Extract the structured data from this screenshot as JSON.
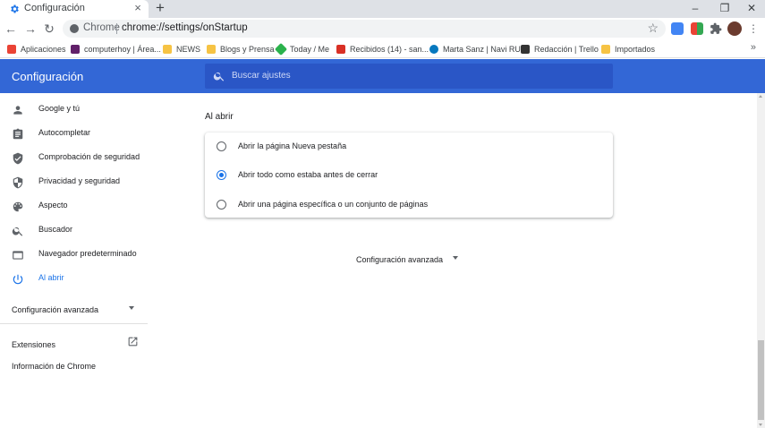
{
  "browser": {
    "tab_title": "Configuración",
    "tab_close": "×",
    "new_tab": "+",
    "window_buttons": {
      "minimize": "–",
      "restore": "❐",
      "close": "✕"
    },
    "nav": {
      "back": "←",
      "forward": "→",
      "reload": "↻"
    },
    "omnibox": {
      "site": "Chrome",
      "url": "chrome://settings/onStartup",
      "star": "☆"
    },
    "menu": "⋮",
    "colors": {
      "tabstrip": "#dee1e6",
      "accent": "#1a73e8"
    }
  },
  "bookmarks": [
    {
      "label": "Aplicaciones",
      "icon": "apps-grid-icon",
      "color": "#ea4335"
    },
    {
      "label": "computerhoy | Área...",
      "icon": "slack-icon",
      "color": "#611f69"
    },
    {
      "label": "NEWS",
      "icon": "folder-icon",
      "color": "#f6c344"
    },
    {
      "label": "Blogs y Prensa",
      "icon": "folder-icon",
      "color": "#f6c344"
    },
    {
      "label": "Today / Me",
      "icon": "feedly-icon",
      "color": "#2bb24c"
    },
    {
      "label": "Recibidos (14) - san...",
      "icon": "gmail-icon",
      "color": "#d93025"
    },
    {
      "label": "Marta Sanz | Navi RU",
      "icon": "drupal-icon",
      "color": "#0678be"
    },
    {
      "label": "Redacción | Trello",
      "icon": "trello-icon",
      "color": "#333333"
    },
    {
      "label": "Importados",
      "icon": "folder-icon",
      "color": "#f6c344"
    }
  ],
  "bookmarks_more": "»",
  "header": {
    "title": "Configuración",
    "search_placeholder": "Buscar ajustes",
    "color": "#3367d6"
  },
  "sidebar": {
    "items": [
      {
        "label": "Google y tú",
        "icon": "person-icon",
        "active": false
      },
      {
        "label": "Autocompletar",
        "icon": "clipboard-icon",
        "active": false
      },
      {
        "label": "Comprobación de seguridad",
        "icon": "shield-check-icon",
        "active": false
      },
      {
        "label": "Privacidad y seguridad",
        "icon": "shield-icon",
        "active": false
      },
      {
        "label": "Aspecto",
        "icon": "palette-icon",
        "active": false
      },
      {
        "label": "Buscador",
        "icon": "search-icon",
        "active": false
      },
      {
        "label": "Navegador predeterminado",
        "icon": "browser-icon",
        "active": false
      },
      {
        "label": "Al abrir",
        "icon": "power-icon",
        "active": true
      }
    ],
    "advanced": "Configuración avanzada",
    "extensions": "Extensiones",
    "about": "Información de Chrome"
  },
  "main": {
    "section_title": "Al abrir",
    "options": [
      {
        "label": "Abrir la página Nueva pestaña",
        "checked": false
      },
      {
        "label": "Abrir todo como estaba antes de cerrar",
        "checked": true
      },
      {
        "label": "Abrir una página específica o un conjunto de páginas",
        "checked": false
      }
    ],
    "advanced": "Configuración avanzada"
  }
}
